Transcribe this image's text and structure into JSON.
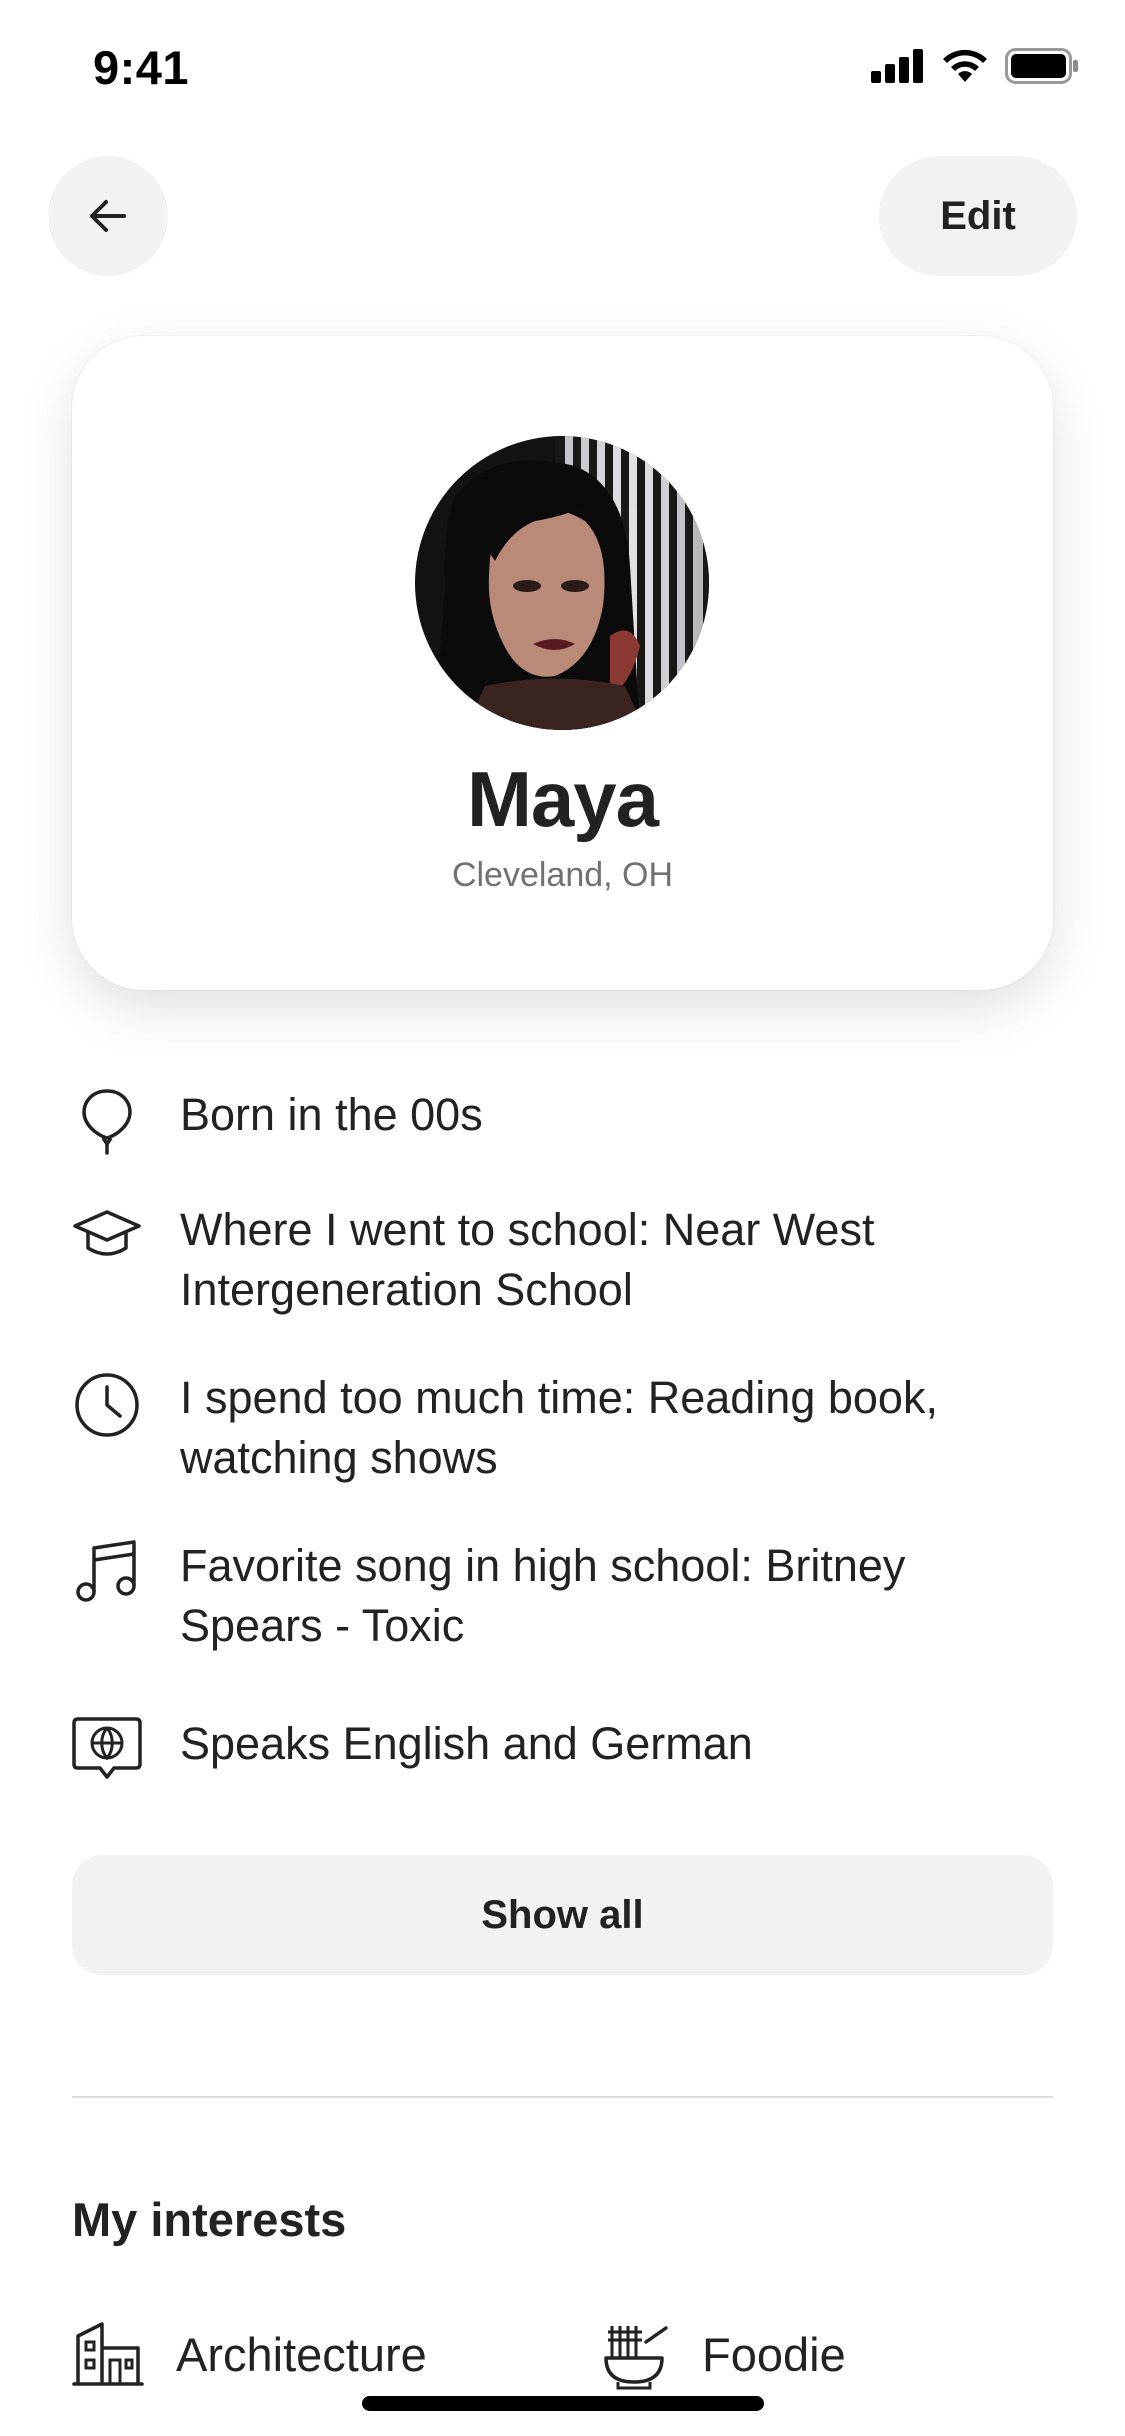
{
  "status_bar": {
    "time": "9:41"
  },
  "nav": {
    "edit_label": "Edit"
  },
  "profile": {
    "name": "Maya",
    "location": "Cleveland, OH"
  },
  "facts": [
    {
      "icon": "balloon-icon",
      "text": "Born in the 00s"
    },
    {
      "icon": "graduation-cap-icon",
      "text": "Where I went to school: Near West Intergeneration School"
    },
    {
      "icon": "clock-icon",
      "text": "I spend too much time: Reading book, watching shows"
    },
    {
      "icon": "music-note-icon",
      "text": "Favorite song in high school: Britney Spears - Toxic"
    },
    {
      "icon": "language-globe-icon",
      "text": "Speaks English and German"
    }
  ],
  "show_all_label": "Show all",
  "interests": {
    "title": "My interests",
    "items": [
      {
        "icon": "building-icon",
        "label": "Architecture"
      },
      {
        "icon": "noodles-icon",
        "label": "Foodie"
      }
    ]
  }
}
